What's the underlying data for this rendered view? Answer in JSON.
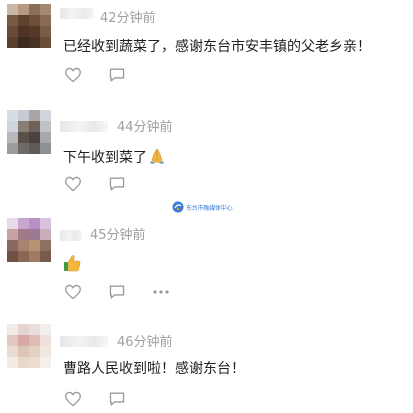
{
  "comments": [
    {
      "time": "42分钟前",
      "text": "已经收到蔬菜了，感谢东台市安丰镇的父老乡亲！",
      "emoji": "",
      "like_icon": "heart-outline-icon",
      "reply_icon": "comment-bubble-icon"
    },
    {
      "time": "44分钟前",
      "text": "下午收到菜了",
      "emoji": "folded-hands-emoji",
      "like_icon": "heart-outline-icon",
      "reply_icon": "comment-bubble-icon"
    },
    {
      "time": "45分钟前",
      "text": "",
      "emoji": "thumbs-up-emoji",
      "like_icon": "heart-outline-icon",
      "reply_icon": "comment-bubble-icon",
      "more_icon": "more-dots-icon"
    },
    {
      "time": "46分钟前",
      "text": "曹路人民收到啦！感谢东台！",
      "emoji": "",
      "like_icon": "heart-outline-icon",
      "reply_icon": "comment-bubble-icon"
    }
  ],
  "watermark": {
    "text": "东台市融媒体中心"
  },
  "colors": {
    "text": "#1f1f1f",
    "meta": "#a0a0a0",
    "icon": "#9a9a9a",
    "accent": "#3a7bd5"
  }
}
